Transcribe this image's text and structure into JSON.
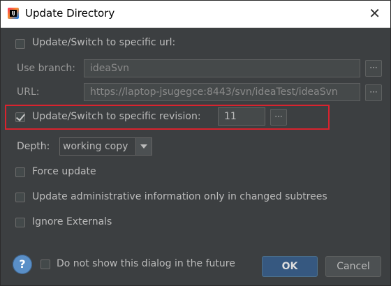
{
  "window": {
    "title": "Update Directory",
    "close_glyph": "✕",
    "app_icon_text": "IJ"
  },
  "switch_url": {
    "checkbox_label": "Update/Switch to specific url:",
    "checked": false,
    "branch_label": "Use branch:",
    "branch_value": "ideaSvn",
    "url_label": "URL:",
    "url_value": "https://laptop-jsugegce:8443/svn/ideaTest/ideaSvn"
  },
  "revision": {
    "checkbox_label": "Update/Switch to specific revision:",
    "checked": true,
    "value": "11"
  },
  "browse_label": "···",
  "depth": {
    "label": "Depth:",
    "value": "working copy"
  },
  "options": [
    {
      "label": "Force update",
      "checked": false
    },
    {
      "label": "Update administrative information only in changed subtrees",
      "checked": false
    },
    {
      "label": "Ignore Externals",
      "checked": false
    }
  ],
  "footer": {
    "help_label": "?",
    "dont_show_label": "Do not show this dialog in the future",
    "ok_label": "OK",
    "cancel_label": "Cancel"
  },
  "colors": {
    "background": "#3c3f41",
    "highlight_border": "#d9232e",
    "ok_button": "#365880"
  }
}
